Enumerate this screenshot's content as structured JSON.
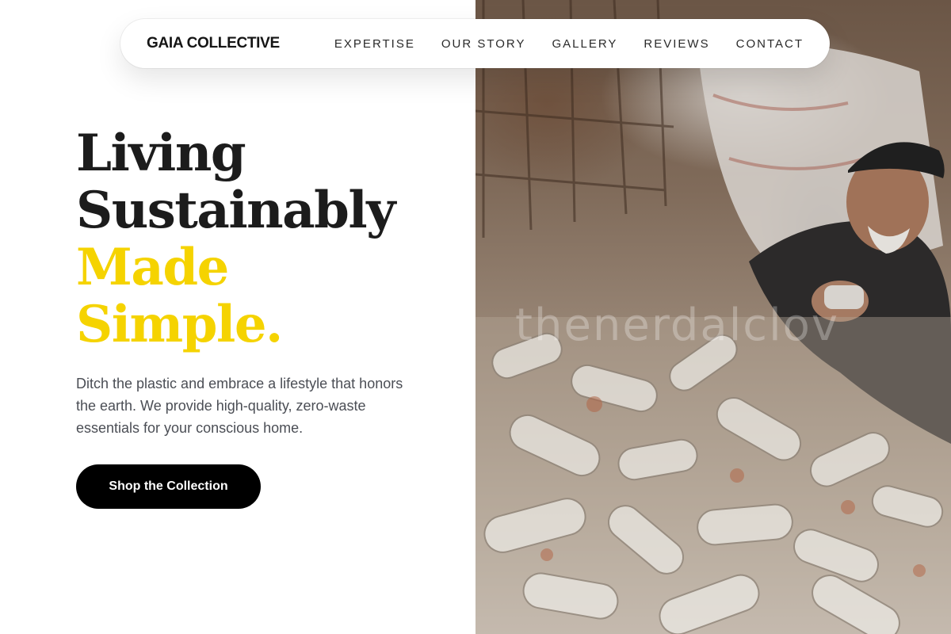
{
  "nav": {
    "brand": "GAIA COLLECTIVE",
    "links": [
      "EXPERTISE",
      "OUR STORY",
      "GALLERY",
      "REVIEWS",
      "CONTACT"
    ]
  },
  "hero": {
    "title_line1": "Living",
    "title_line2": "Sustainably",
    "title_line3": "Made",
    "title_line4": "Simple.",
    "description": "Ditch the plastic and embrace a lifestyle that honors the earth. We provide high-quality, zero-waste essentials for your conscious home.",
    "cta_label": "Shop the Collection"
  },
  "image": {
    "subject": "man-sorting-plastic-bottles-photo",
    "watermark": "thenerdalclov"
  },
  "colors": {
    "accent": "#f5d300",
    "text_dark": "#1c1c1c",
    "button": "#000000",
    "body_text": "#4b4e55"
  }
}
